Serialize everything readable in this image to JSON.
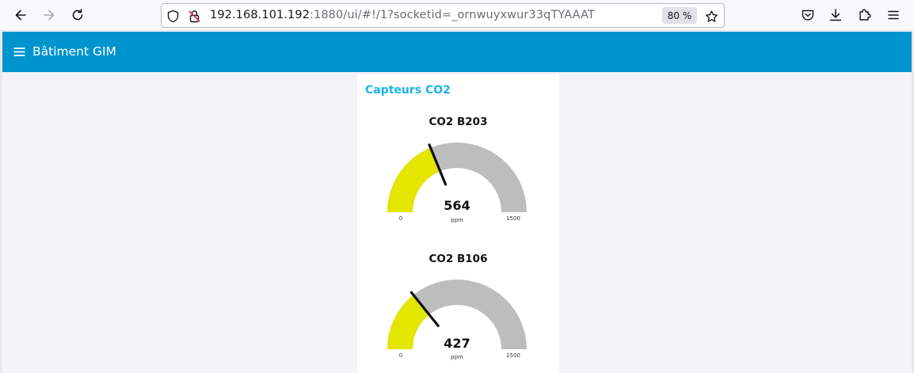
{
  "browser": {
    "url_host": "192.168.101.192",
    "url_rest": ":1880/ui/#!/1?socketid=_ornwuyxwur33qTYAAAT",
    "zoom": "80 %"
  },
  "dashboard": {
    "title": "Bâtiment GIM",
    "group_title": "Capteurs CO2",
    "gauges": [
      {
        "title": "CO2 B203",
        "value": "564",
        "unit": "ppm",
        "min": "0",
        "max": "1500"
      },
      {
        "title": "CO2 B106",
        "value": "427",
        "unit": "ppm",
        "min": "0",
        "max": "1500"
      }
    ]
  },
  "colors": {
    "header": "#0094ce",
    "group_title": "#1bb5e8",
    "gauge_fill": "#e2e600",
    "gauge_track": "#bdbdbd",
    "needle": "#111111"
  }
}
